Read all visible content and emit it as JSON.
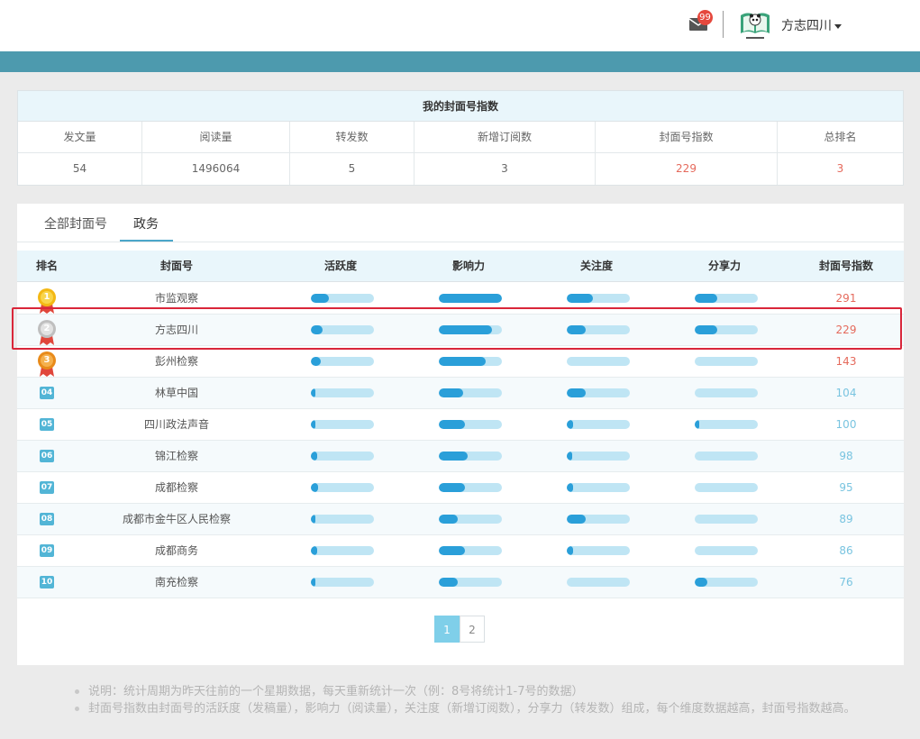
{
  "header": {
    "mail_icon": "envelope-icon",
    "mail_count": "99",
    "avatar_icon": "panda-book-logo",
    "username": "方志四川"
  },
  "index_panel": {
    "title": "我的封面号指数",
    "columns": [
      "发文量",
      "阅读量",
      "转发数",
      "新增订阅数",
      "封面号指数",
      "总排名"
    ],
    "values": [
      "54",
      "1496064",
      "5",
      "3",
      "229",
      "3"
    ]
  },
  "tabs": [
    {
      "label": "全部封面号",
      "active": false
    },
    {
      "label": "政务",
      "active": true
    }
  ],
  "ranking": {
    "columns": [
      "排名",
      "封面号",
      "活跃度",
      "影响力",
      "关注度",
      "分享力",
      "封面号指数"
    ],
    "rows": [
      {
        "rank": "1",
        "name": "市监观察",
        "activity": 0.28,
        "influence": 1.0,
        "attention": 0.42,
        "share": 0.36,
        "score": "291"
      },
      {
        "rank": "2",
        "name": "方志四川",
        "activity": 0.18,
        "influence": 0.84,
        "attention": 0.3,
        "share": 0.36,
        "score": "229"
      },
      {
        "rank": "3",
        "name": "彭州检察",
        "activity": 0.16,
        "influence": 0.74,
        "attention": 0.0,
        "share": 0.0,
        "score": "143"
      },
      {
        "rank": "04",
        "name": "林草中国",
        "activity": 0.04,
        "influence": 0.38,
        "attention": 0.3,
        "share": 0.0,
        "score": "104"
      },
      {
        "rank": "05",
        "name": "四川政法声音",
        "activity": 0.04,
        "influence": 0.42,
        "attention": 0.1,
        "share": 0.05,
        "score": "100"
      },
      {
        "rank": "06",
        "name": "锦江检察",
        "activity": 0.1,
        "influence": 0.46,
        "attention": 0.08,
        "share": 0.0,
        "score": "98"
      },
      {
        "rank": "07",
        "name": "成都检察",
        "activity": 0.12,
        "influence": 0.42,
        "attention": 0.1,
        "share": 0.0,
        "score": "95"
      },
      {
        "rank": "08",
        "name": "成都市金牛区人民检察",
        "activity": 0.04,
        "influence": 0.3,
        "attention": 0.3,
        "share": 0.0,
        "score": "89"
      },
      {
        "rank": "09",
        "name": "成都商务",
        "activity": 0.1,
        "influence": 0.42,
        "attention": 0.1,
        "share": 0.0,
        "score": "86"
      },
      {
        "rank": "10",
        "name": "南充检察",
        "activity": 0.04,
        "influence": 0.3,
        "attention": 0.0,
        "share": 0.2,
        "score": "76"
      }
    ]
  },
  "pagination": {
    "pages": [
      "1",
      "2"
    ],
    "current": "1"
  },
  "notes": [
    "说明：统计周期为昨天往前的一个星期数据，每天重新统计一次（例：8号将统计1-7号的数据）",
    "封面号指数由封面号的活跃度（发稿量），影响力（阅读量），关注度（新增订阅数），分享力（转发数）组成，每个维度数据越高，封面号指数越高。"
  ],
  "colors": {
    "teal_band": "#4d9aae",
    "bar_fill": "#2a9fd9",
    "bar_track": "#bfe5f4",
    "score_red": "#e56a5c",
    "score_blue": "#79c4e0",
    "highlight": "#d9263a"
  }
}
